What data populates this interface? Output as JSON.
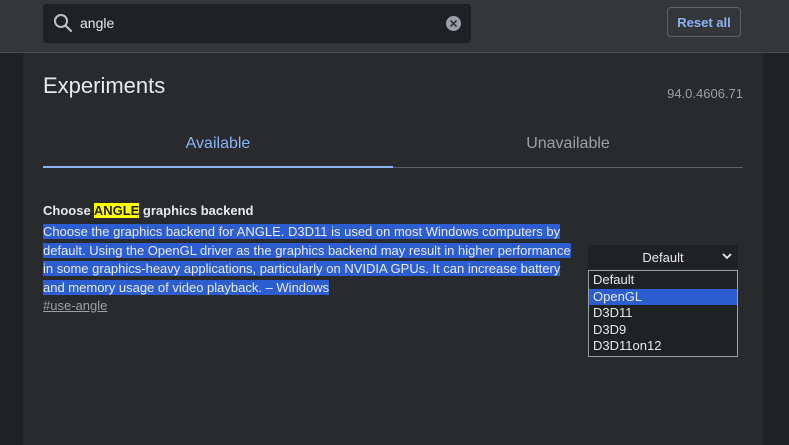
{
  "search": {
    "value": "angle"
  },
  "header": {
    "reset_label": "Reset all"
  },
  "page": {
    "title": "Experiments",
    "version": "94.0.4606.71"
  },
  "tabs": [
    {
      "label": "Available",
      "active": true
    },
    {
      "label": "Unavailable",
      "active": false
    }
  ],
  "experiment": {
    "title_prefix": "Choose ",
    "title_highlight": "ANGLE",
    "title_suffix": " graphics backend",
    "description": "Choose the graphics backend for ANGLE. D3D11 is used on most Windows computers by default. Using the OpenGL driver as the graphics backend may result in higher performance in some graphics-heavy applications, particularly on NVIDIA GPUs. It can increase battery and memory usage of video playback. – Windows",
    "link": "#use-angle",
    "select_value": "Default",
    "options": [
      "Default",
      "OpenGL",
      "D3D11",
      "D3D9",
      "D3D11on12"
    ],
    "highlighted_option": "OpenGL"
  },
  "colors": {
    "accent": "#8ab4f8",
    "search_highlight": "#ffff00",
    "selection": "#2d5ed1",
    "background": "#202124",
    "panel": "#292a2d"
  },
  "icons": {
    "search": "search-icon",
    "clear": "clear-icon",
    "dropdown": "chevron-down-icon"
  }
}
